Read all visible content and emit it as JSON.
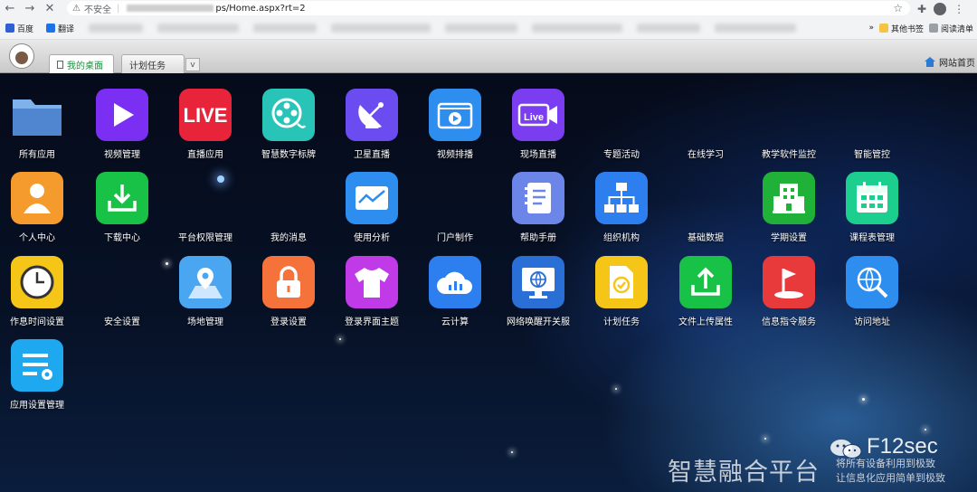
{
  "browser": {
    "security_label": "不安全",
    "url_suffix": "ps/Home.aspx?rt=2",
    "bookmarks": {
      "first": "百度",
      "second": "翻译",
      "other": "其他书签",
      "reading": "阅读清单",
      "more": "»"
    }
  },
  "header": {
    "tabs": [
      {
        "label": "我的桌面"
      },
      {
        "label": "计划任务"
      }
    ],
    "close_label": "v",
    "home_link": "网站首页"
  },
  "desktop": {
    "apps": [
      {
        "label": "所有应用",
        "icon": "folder-icon",
        "color": "#5b8fd6"
      },
      {
        "label": "视频管理",
        "icon": "play-icon",
        "color": "#7b2ff2"
      },
      {
        "label": "直播应用",
        "icon": "live-icon",
        "color": "#e8243a"
      },
      {
        "label": "智慧数字标牌",
        "icon": "film-reel-icon",
        "color": "#28c4b8"
      },
      {
        "label": "卫星直播",
        "icon": "satellite-dish-icon",
        "color": "#6b4cf0"
      },
      {
        "label": "视频排播",
        "icon": "video-schedule-icon",
        "color": "#2d8ef0"
      },
      {
        "label": "现场直播",
        "icon": "live-camera-icon",
        "color": "#7a3ef0"
      },
      {
        "label": "专题活动",
        "icon": "",
        "color": ""
      },
      {
        "label": "在线学习",
        "icon": "",
        "color": ""
      },
      {
        "label": "教学软件监控",
        "icon": "",
        "color": ""
      },
      {
        "label": "智能管控",
        "icon": "",
        "color": ""
      },
      {
        "label": "个人中心",
        "icon": "person-icon",
        "color": "#f59a2c"
      },
      {
        "label": "下载中心",
        "icon": "download-icon",
        "color": "#18c246"
      },
      {
        "label": "平台权限管理",
        "icon": "",
        "color": ""
      },
      {
        "label": "我的消息",
        "icon": "",
        "color": ""
      },
      {
        "label": "使用分析",
        "icon": "analytics-icon",
        "color": "#2d8ef0"
      },
      {
        "label": "门户制作",
        "icon": "",
        "color": ""
      },
      {
        "label": "帮助手册",
        "icon": "notebook-icon",
        "color": "#6b86e8"
      },
      {
        "label": "组织机构",
        "icon": "org-chart-icon",
        "color": "#2d7ff0"
      },
      {
        "label": "基础数据",
        "icon": "",
        "color": ""
      },
      {
        "label": "学期设置",
        "icon": "building-icon",
        "color": "#20b238"
      },
      {
        "label": "课程表管理",
        "icon": "calendar-icon",
        "color": "#1ccf8e"
      },
      {
        "label": "作息时间设置",
        "icon": "clock-icon",
        "color": "#f5c518"
      },
      {
        "label": "安全设置",
        "icon": "",
        "color": ""
      },
      {
        "label": "场地管理",
        "icon": "map-pin-icon",
        "color": "#4aa6f0"
      },
      {
        "label": "登录设置",
        "icon": "lock-icon",
        "color": "#f5733a"
      },
      {
        "label": "登录界面主题",
        "icon": "tshirt-icon",
        "color": "#c13ae8"
      },
      {
        "label": "云计算",
        "icon": "cloud-icon",
        "color": "#2d7ff0"
      },
      {
        "label": "网络唤醒开关服",
        "icon": "monitor-globe-icon",
        "color": "#2a6fd6"
      },
      {
        "label": "计划任务",
        "icon": "task-doc-icon",
        "color": "#f5c518"
      },
      {
        "label": "文件上传属性",
        "icon": "upload-icon",
        "color": "#18c246"
      },
      {
        "label": "信息指令服务",
        "icon": "flag-icon",
        "color": "#e83a3a"
      },
      {
        "label": "访问地址",
        "icon": "globe-search-icon",
        "color": "#2d8ef0"
      },
      {
        "label": "应用设置管理",
        "icon": "settings-list-icon",
        "color": "#1da8f0"
      }
    ]
  },
  "watermark": {
    "title": "智慧融合平台",
    "brand": "F12sec",
    "line1": "将所有设备利用到极致",
    "line2": "让信息化应用简单到极致"
  }
}
